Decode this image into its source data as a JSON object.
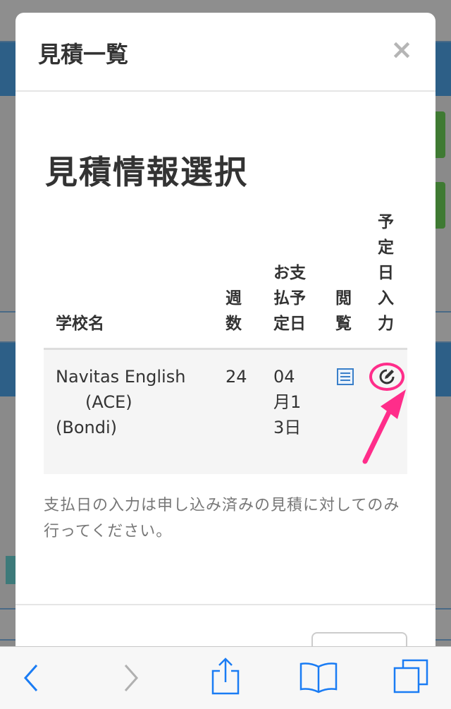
{
  "modal": {
    "title": "見積一覧",
    "close_glyph": "×",
    "section_title": "見積情報選択"
  },
  "table": {
    "headers": {
      "school": "学校名",
      "weeks": "週数",
      "pay_date": "お支払予定日",
      "view": "閲覧",
      "plan_input": "予定日入力"
    },
    "rows": [
      {
        "school_line1": "Navitas English",
        "school_line2": "(ACE)",
        "school_line3": "(Bondi)",
        "weeks": "24",
        "pay_date": "04月13日",
        "view_icon": "list-icon",
        "edit_icon": "edit-icon"
      }
    ]
  },
  "note": "支払日の入力は申し込み済みの見積に対してのみ行ってください。",
  "toolbar": {
    "back_icon": "chevron-left-icon",
    "forward_icon": "chevron-right-icon",
    "share_icon": "share-icon",
    "bookmarks_icon": "book-icon",
    "tabs_icon": "tabs-icon"
  },
  "colors": {
    "accent": "#3a7fc9",
    "highlight": "#ff2d8a",
    "ios_blue": "#1a7cf4"
  }
}
